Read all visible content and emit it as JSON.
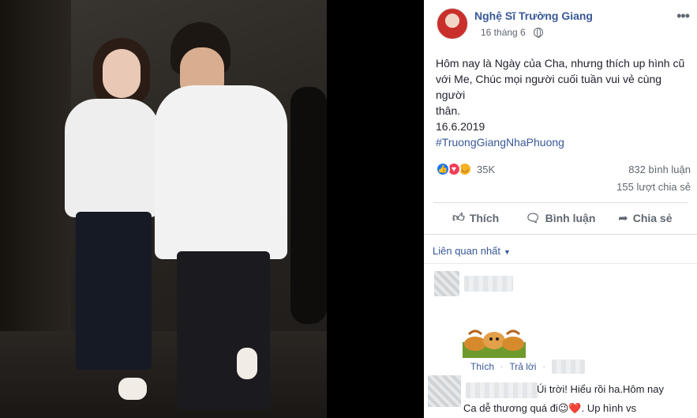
{
  "post": {
    "page_name": "Nghệ Sĩ Trường Giang",
    "date": "16 tháng 6",
    "text_lines": [
      "Hôm nay là Ngày của Cha, nhưng thích up hình cũ",
      "với Me, Chúc mọi người cuối tuần vui vẻ cùng người",
      "thân."
    ],
    "date_line": "16.6.2019",
    "hashtag": "#TruongGiangNhaPhuong"
  },
  "stats": {
    "reactions_count": "35K",
    "comments": "832 bình luận",
    "shares": "155 lượt chia sẻ",
    "reaction_icons": [
      "like-icon",
      "love-icon",
      "haha-icon"
    ]
  },
  "actions": {
    "like": "Thích",
    "comment": "Bình luận",
    "share": "Chia sẻ"
  },
  "comments": {
    "sort_label": "Liên quan nhất",
    "reply_like": "Thích",
    "reply_reply": "Trả lời",
    "comment2_line1": "Úi trời! Hiểu rồi ha.Hôm nay",
    "comment2_line2": "Ca dễ thương quá đi😉❤️. Up hình vs"
  },
  "colors": {
    "link": "#385898",
    "muted": "#606770",
    "like_blue": "#1877f2",
    "love_red": "#f33e58",
    "haha_yellow": "#f7b125"
  }
}
